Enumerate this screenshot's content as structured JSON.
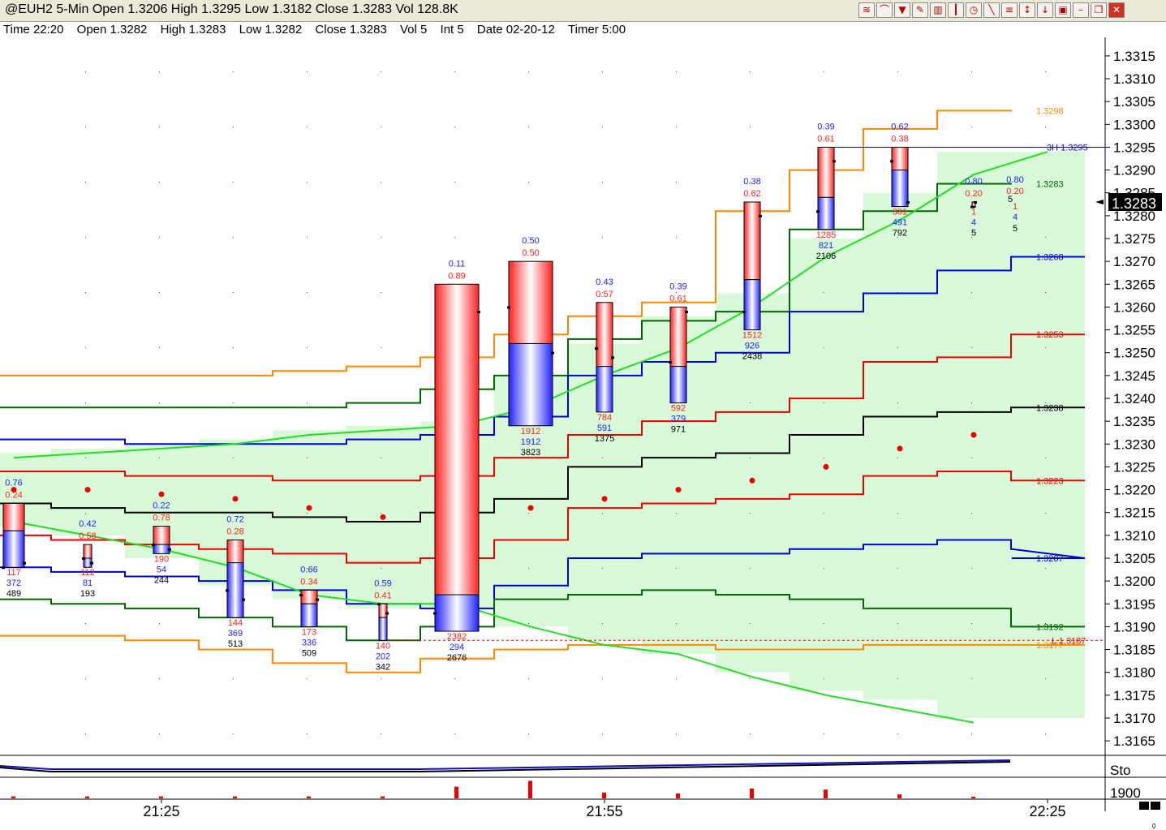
{
  "window": {
    "title": "@EUH2 5-Min Open 1.3206 High 1.3295 Low 1.3182 Close 1.3283 Vol 128.8K",
    "toolbar_icons": [
      "layers-icon",
      "arc-icon",
      "filter-icon",
      "pencil-icon",
      "bar-chart-icon",
      "candlestick-icon",
      "clock-icon",
      "draw-line-icon",
      "trendline-icon",
      "fib-icon",
      "arrow-down-icon",
      "trash-icon",
      "minimize-icon",
      "restore-icon",
      "close-icon"
    ]
  },
  "databar": {
    "time": "Time 22:20",
    "open": "Open 1.3282",
    "high": "High 1.3283",
    "low": "Low 1.3282",
    "close": "Close 1.3283",
    "vol": "Vol 5",
    "int": "Int 5",
    "date": "Date 02-20-12",
    "timer": "Timer 5:00"
  },
  "colors": {
    "buy": "#2020ff",
    "sell": "#ff2020",
    "band_fill": "#d8fad8",
    "vwap": "#22dd22",
    "orange": "#ff8800",
    "darkgreen": "#006600",
    "blue": "#0000dd",
    "red": "#ee0000",
    "black": "#000000"
  },
  "chart_data": {
    "type": "bar",
    "title": "@EUH2 5-Min",
    "ylim": [
      1.3162,
      1.3318
    ],
    "yticks": [
      "1.3165",
      "1.3170",
      "1.3175",
      "1.3180",
      "1.3185",
      "1.3190",
      "1.3195",
      "1.3200",
      "1.3205",
      "1.3210",
      "1.3215",
      "1.3220",
      "1.3225",
      "1.3230",
      "1.3235",
      "1.3240",
      "1.3245",
      "1.3250",
      "1.3255",
      "1.3260",
      "1.3265",
      "1.3270",
      "1.3275",
      "1.3280",
      "1.3285",
      "1.3290",
      "1.3295",
      "1.3300",
      "1.3305",
      "1.3310",
      "1.3315"
    ],
    "xticks": [
      "21:25",
      "21:55",
      "22:25"
    ],
    "last_price": "1.3283",
    "bars": [
      {
        "x": 0,
        "open": 1.3203,
        "high": 1.3217,
        "low": 1.3203,
        "close": 1.3204,
        "split": 1.3211,
        "ratio_buy": "0.76",
        "ratio_sell": "0.24",
        "sell": "117",
        "buy": "372",
        "total": "489"
      },
      {
        "x": 1,
        "open": 1.3205,
        "high": 1.3208,
        "low": 1.3203,
        "close": 1.3204,
        "split": 1.3205,
        "ratio_buy": "0.42",
        "ratio_sell": "0.58",
        "sell": "112",
        "buy": "81",
        "total": "193"
      },
      {
        "x": 2,
        "open": 1.3208,
        "high": 1.3212,
        "low": 1.3206,
        "close": 1.3207,
        "split": 1.3208,
        "ratio_buy": "0.22",
        "ratio_sell": "0.78",
        "sell": "190",
        "buy": "54",
        "total": "244"
      },
      {
        "x": 3,
        "open": 1.3198,
        "high": 1.3209,
        "low": 1.3192,
        "close": 1.3196,
        "split": 1.3204,
        "ratio_buy": "0.72",
        "ratio_sell": "0.28",
        "sell": "144",
        "buy": "369",
        "total": "513"
      },
      {
        "x": 4,
        "open": 1.3197,
        "high": 1.3198,
        "low": 1.319,
        "close": 1.3196,
        "split": 1.3195,
        "ratio_buy": "0.66",
        "ratio_sell": "0.34",
        "sell": "173",
        "buy": "336",
        "total": "509"
      },
      {
        "x": 5,
        "open": 1.3195,
        "high": 1.3195,
        "low": 1.3187,
        "close": 1.3193,
        "split": 1.3192,
        "ratio_buy": "0.59",
        "ratio_sell": "0.41",
        "sell": "140",
        "buy": "202",
        "total": "342"
      },
      {
        "x": 6,
        "open": 1.3193,
        "high": 1.3265,
        "low": 1.3189,
        "close": 1.3259,
        "split": 1.3197,
        "ratio_buy": "0.11",
        "ratio_sell": "0.89",
        "sell": "2382",
        "buy": "294",
        "total": "2676"
      },
      {
        "x": 7,
        "open": 1.326,
        "high": 1.327,
        "low": 1.3234,
        "close": 1.325,
        "split": 1.3252,
        "ratio_buy": "0.50",
        "ratio_sell": "0.50",
        "sell": "1912",
        "buy": "1912",
        "total": "3823"
      },
      {
        "x": 8,
        "open": 1.3251,
        "high": 1.3261,
        "low": 1.3237,
        "close": 1.3249,
        "split": 1.3247,
        "ratio_buy": "0.43",
        "ratio_sell": "0.57",
        "sell": "784",
        "buy": "591",
        "total": "1375"
      },
      {
        "x": 9,
        "open": 1.3248,
        "high": 1.326,
        "low": 1.3239,
        "close": 1.3259,
        "split": 1.3247,
        "ratio_buy": "0.39",
        "ratio_sell": "0.61",
        "sell": "592",
        "buy": "379",
        "total": "971"
      },
      {
        "x": 10,
        "open": 1.3259,
        "high": 1.3283,
        "low": 1.3255,
        "close": 1.328,
        "split": 1.3266,
        "ratio_buy": "0.38",
        "ratio_sell": "0.62",
        "sell": "1512",
        "buy": "926",
        "total": "2438"
      },
      {
        "x": 11,
        "open": 1.3281,
        "high": 1.3295,
        "low": 1.3277,
        "close": 1.3292,
        "split": 1.3284,
        "ratio_buy": "0.39",
        "ratio_sell": "0.61",
        "sell": "1285",
        "buy": "821",
        "total": "2106"
      },
      {
        "x": 12,
        "open": 1.3292,
        "high": 1.3295,
        "low": 1.3282,
        "close": 1.3283,
        "split": 1.329,
        "ratio_buy": "0.62",
        "ratio_sell": "0.38",
        "sell": "301",
        "buy": "491",
        "total": "792"
      },
      {
        "x": 13,
        "open": 1.3282,
        "high": 1.3283,
        "low": 1.3282,
        "close": 1.3283,
        "split": 1.3282,
        "ratio_buy": "0.80",
        "ratio_sell": "0.20",
        "sell": "1",
        "buy": "4",
        "total": "5"
      }
    ],
    "current_bar_counter": "5",
    "trail_buy": "0.80",
    "trail_sell": "0.20",
    "trail_sell_count": "1",
    "trail_buy_count": "4",
    "trail_total": "5",
    "step_lines": [
      {
        "color": "orange",
        "label": "1.3298",
        "values": [
          1.3245,
          1.3245,
          1.3245,
          1.3245,
          1.3246,
          1.3247,
          1.3249,
          1.3254,
          1.3258,
          1.3261,
          1.3281,
          1.329,
          1.3299,
          1.3303,
          1.3303
        ]
      },
      {
        "color": "darkgreen",
        "label": "1.3283",
        "values": [
          1.3238,
          1.3238,
          1.3238,
          1.3238,
          1.3238,
          1.3239,
          1.3242,
          1.3245,
          1.3253,
          1.3257,
          1.3259,
          1.3277,
          1.3281,
          1.3287,
          1.3287
        ]
      },
      {
        "color": "blue",
        "label": "1.3268",
        "values": [
          1.3231,
          1.3231,
          1.323,
          1.323,
          1.323,
          1.3231,
          1.3232,
          1.3236,
          1.3245,
          1.3248,
          1.325,
          1.3259,
          1.3263,
          1.3268,
          1.3271,
          1.3271
        ]
      },
      {
        "color": "red",
        "label": "1.3253",
        "values": [
          1.3224,
          1.3224,
          1.3223,
          1.3223,
          1.3222,
          1.3222,
          1.3223,
          1.3227,
          1.3232,
          1.3235,
          1.3237,
          1.324,
          1.3248,
          1.3249,
          1.3254,
          1.3254
        ]
      },
      {
        "color": "black",
        "label": "1.3238",
        "values": [
          1.3217,
          1.3216,
          1.3215,
          1.3215,
          1.3214,
          1.3213,
          1.3215,
          1.3218,
          1.3225,
          1.3227,
          1.3228,
          1.3232,
          1.3236,
          1.3237,
          1.3238,
          1.3238
        ]
      },
      {
        "color": "red",
        "label": "1.3223",
        "values": [
          1.321,
          1.3209,
          1.3208,
          1.3207,
          1.3206,
          1.3204,
          1.3205,
          1.3209,
          1.3216,
          1.3217,
          1.3218,
          1.3219,
          1.3223,
          1.3224,
          1.3222,
          1.3222
        ]
      },
      {
        "color": "blue",
        "label": "1.3207",
        "values": [
          1.3203,
          1.3202,
          1.3201,
          1.32,
          1.3198,
          1.3195,
          1.3194,
          1.3199,
          1.3205,
          1.3206,
          1.3206,
          1.3207,
          1.3208,
          1.3209,
          1.3207,
          1.3205
        ]
      },
      {
        "color": "darkgreen",
        "label": "1.3192",
        "values": [
          1.3196,
          1.3195,
          1.3194,
          1.3192,
          1.319,
          1.3187,
          1.319,
          1.3196,
          1.3197,
          1.3198,
          1.3197,
          1.3196,
          1.3194,
          1.3194,
          1.319,
          1.319
        ]
      },
      {
        "color": "orange",
        "label": "1.3177",
        "values": [
          1.3188,
          1.3188,
          1.3187,
          1.3185,
          1.3182,
          1.318,
          1.3183,
          1.3185,
          1.3186,
          1.3186,
          1.3185,
          1.3185,
          1.3186,
          1.3186,
          1.3186,
          1.3186
        ]
      }
    ],
    "vwap": [
      1.3227,
      1.3228,
      1.3229,
      1.323,
      1.3232,
      1.3233,
      1.3234,
      1.3238,
      1.3245,
      1.3251,
      1.326,
      1.3271,
      1.3279,
      1.3289,
      1.3294
    ],
    "vwap_low": [
      1.3213,
      1.321,
      1.3207,
      1.3203,
      1.3197,
      1.3195,
      1.3195,
      1.319,
      1.3186,
      1.3184,
      1.3179,
      1.3175,
      1.3172,
      1.3169
    ],
    "band_upper": [
      1.3228,
      1.3229,
      1.323,
      1.3231,
      1.3233,
      1.3234,
      1.3235,
      1.3245,
      1.3252,
      1.3258,
      1.3263,
      1.3275,
      1.3285,
      1.3294,
      1.3294
    ],
    "band_lower": [
      1.3212,
      1.321,
      1.3205,
      1.3199,
      1.3196,
      1.3194,
      1.3194,
      1.319,
      1.3187,
      1.3184,
      1.318,
      1.3176,
      1.3174,
      1.317,
      1.317
    ],
    "red_dots": [
      1.322,
      1.322,
      1.3219,
      1.3218,
      1.3216,
      1.3214,
      null,
      1.3216,
      1.3218,
      1.322,
      1.3222,
      1.3225,
      1.3229,
      1.3232
    ],
    "hl_lines": [
      {
        "label": "3H 1.3295",
        "value": 1.3295,
        "color": "blue"
      },
      {
        "label": "L 1.3187",
        "value": 1.3187,
        "color": "red"
      }
    ],
    "lower_panel": {
      "label": "Sto",
      "volume_label": "1900",
      "bottom_label": "0"
    },
    "volume_spikes": [
      0.1,
      0.1,
      0.1,
      0.1,
      0.1,
      0.1,
      0.6,
      0.9,
      0.3,
      0.25,
      0.5,
      0.45,
      0.2,
      0.05
    ]
  }
}
